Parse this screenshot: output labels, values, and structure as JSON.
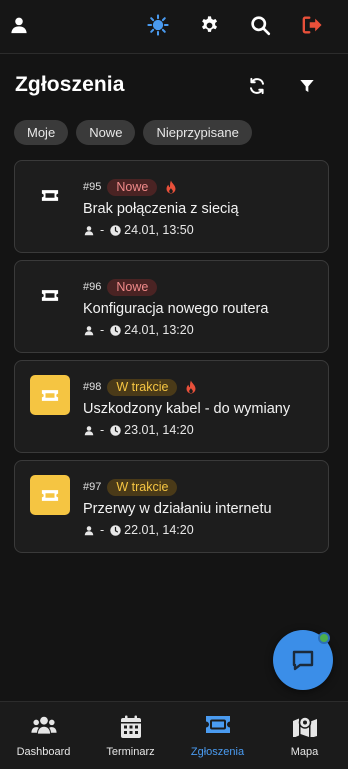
{
  "header": {
    "icons": [
      "user-icon",
      "sun-icon",
      "gear-icon",
      "search-icon",
      "logout-icon"
    ],
    "accent_sun": "#4a9bf0",
    "logout_color": "#e8503a"
  },
  "page": {
    "title": "Zgłoszenia",
    "icons": [
      "refresh-icon",
      "filter-icon"
    ]
  },
  "filters": [
    "Moje",
    "Nowe",
    "Nieprzypisane"
  ],
  "tickets": [
    {
      "number": "#95",
      "status": "Nowe",
      "status_kind": "nowe",
      "urgent": true,
      "title": "Brak połączenia z siecią",
      "assignee": "-",
      "time": "24.01, 13:50",
      "tile": "dark"
    },
    {
      "number": "#96",
      "status": "Nowe",
      "status_kind": "nowe",
      "urgent": false,
      "title": "Konfiguracja nowego routera",
      "assignee": "-",
      "time": "24.01, 13:20",
      "tile": "dark"
    },
    {
      "number": "#98",
      "status": "W trakcie",
      "status_kind": "trakcie",
      "urgent": true,
      "title": "Uszkodzony kabel - do wymiany",
      "assignee": "-",
      "time": "23.01, 14:20",
      "tile": "yellow"
    },
    {
      "number": "#97",
      "status": "W trakcie",
      "status_kind": "trakcie",
      "urgent": false,
      "title": "Przerwy w działaniu internetu",
      "assignee": "-",
      "time": "22.01, 14:20",
      "tile": "yellow"
    }
  ],
  "colors": {
    "status_new": "#f08a8a",
    "status_in_progress": "#f5c542",
    "urgent_flame": "#e8503a",
    "active_nav": "#4a9bf0"
  },
  "fab": {
    "icon": "chat-icon",
    "has_notification": true
  },
  "nav": [
    {
      "label": "Dashboard",
      "icon": "users-icon",
      "active": false
    },
    {
      "label": "Terminarz",
      "icon": "calendar-icon",
      "active": false
    },
    {
      "label": "Zgłoszenia",
      "icon": "ticket-icon",
      "active": true
    },
    {
      "label": "Mapa",
      "icon": "map-icon",
      "active": false
    }
  ]
}
